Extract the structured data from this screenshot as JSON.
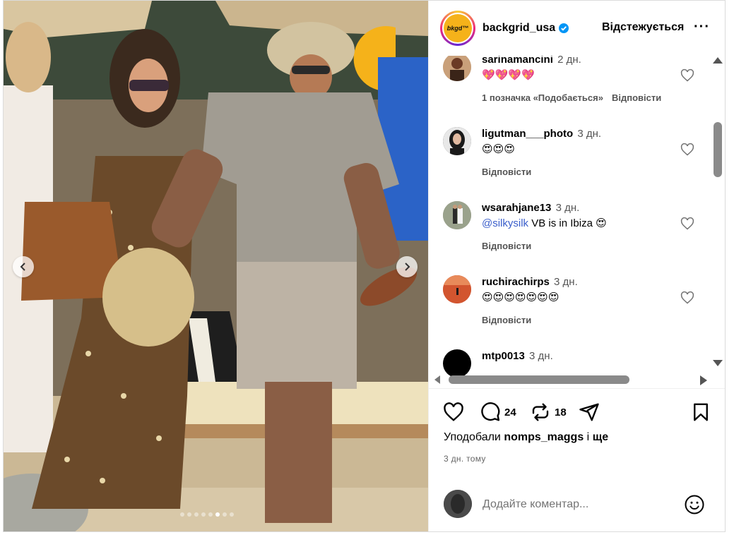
{
  "photo": {
    "prev_label": "‹",
    "next_label": "›",
    "slides": 8,
    "active_slide": 5
  },
  "header": {
    "avatar_text": "bkgd™",
    "username": "backgrid_usa",
    "verified": true,
    "follow_status": "Відстежується",
    "more": "···"
  },
  "comments": [
    {
      "username": "sarinamancini",
      "time": "2 дн.",
      "text": "💖💖💖💖",
      "likes_label": "1 позначка «Подобається»",
      "reply_label": "Відповісти",
      "avatar_color": "#b89370"
    },
    {
      "username": "ligutman___photo",
      "time": "3 дн.",
      "text": "😍😍😍",
      "likes_label": "",
      "reply_label": "Відповісти",
      "avatar_color": "#2c2c2c"
    },
    {
      "username": "wsarahjane13",
      "time": "3 дн.",
      "mention": "@silkysilk",
      "text": " VB is in Ibiza 😍",
      "likes_label": "",
      "reply_label": "Відповісти",
      "avatar_color": "#7a7a6a"
    },
    {
      "username": "ruchirachirps",
      "time": "3 дн.",
      "text": "😍😍😍😍😍😍😍",
      "likes_label": "",
      "reply_label": "Відповісти",
      "avatar_color": "#c8492e"
    },
    {
      "username": "mtp0013",
      "time": "3 дн.",
      "text": "",
      "likes_label": "",
      "reply_label": "",
      "avatar_color": "#000000"
    }
  ],
  "actions": {
    "comment_count": "24",
    "repost_count": "18"
  },
  "likes": {
    "prefix": "Уподобали ",
    "user": "nomps_maggs",
    "suffix": " і ",
    "more": "ще"
  },
  "post_time": "3 дн. тому",
  "add_comment": {
    "placeholder": "Додайте коментар..."
  },
  "colors": {
    "brand_orange": "#f5b21a",
    "verified_blue": "#0095f6",
    "mention_blue": "#3a5ecb"
  }
}
